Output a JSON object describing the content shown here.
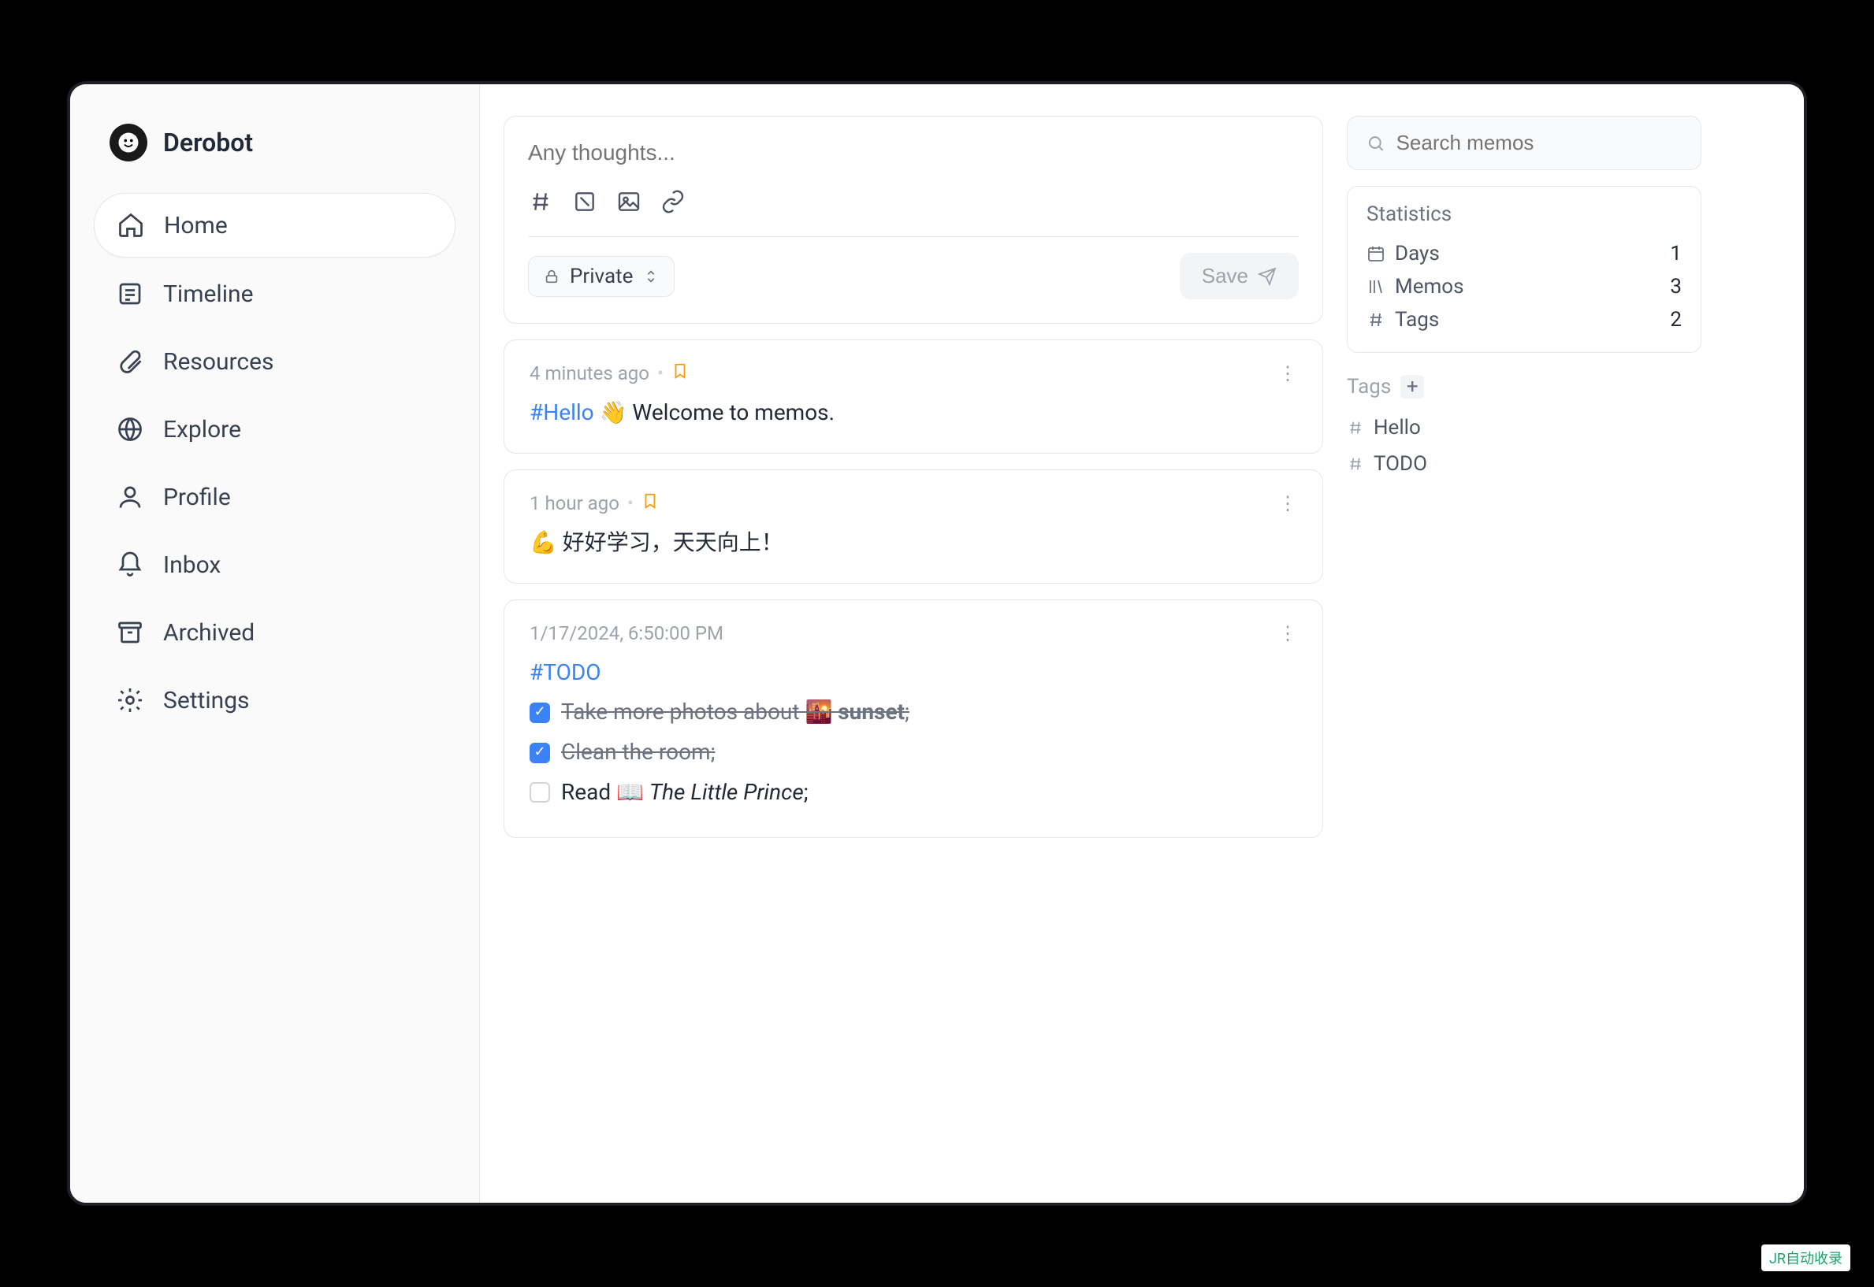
{
  "brand": {
    "name": "Derobot"
  },
  "nav": [
    {
      "id": "home",
      "label": "Home",
      "active": true
    },
    {
      "id": "timeline",
      "label": "Timeline",
      "active": false
    },
    {
      "id": "resources",
      "label": "Resources",
      "active": false
    },
    {
      "id": "explore",
      "label": "Explore",
      "active": false
    },
    {
      "id": "profile",
      "label": "Profile",
      "active": false
    },
    {
      "id": "inbox",
      "label": "Inbox",
      "active": false
    },
    {
      "id": "archived",
      "label": "Archived",
      "active": false
    },
    {
      "id": "settings",
      "label": "Settings",
      "active": false
    }
  ],
  "composer": {
    "placeholder": "Any thoughts...",
    "visibility": "Private",
    "save_label": "Save"
  },
  "memos": [
    {
      "time": "4 minutes ago",
      "pinned": true,
      "tag": "#Hello",
      "body_rest": " 👋 Welcome to memos."
    },
    {
      "time": "1 hour ago",
      "pinned": true,
      "body": "💪 好好学习，天天向上！"
    },
    {
      "time": "1/17/2024, 6:50:00 PM",
      "pinned": false,
      "tag": "#TODO",
      "todos": [
        {
          "done": true,
          "text_pre": "Take more photos about 🌇 ",
          "text_bold": "sunset",
          "text_post": ";"
        },
        {
          "done": true,
          "text": "Clean the room;"
        },
        {
          "done": false,
          "text_pre": "Read 📖 ",
          "text_italic": "The Little Prince",
          "text_post": ";"
        }
      ]
    }
  ],
  "search": {
    "placeholder": "Search memos"
  },
  "statistics": {
    "title": "Statistics",
    "rows": [
      {
        "label": "Days",
        "value": "1"
      },
      {
        "label": "Memos",
        "value": "3"
      },
      {
        "label": "Tags",
        "value": "2"
      }
    ]
  },
  "tags": {
    "title": "Tags",
    "items": [
      {
        "label": "Hello"
      },
      {
        "label": "TODO"
      }
    ]
  },
  "watermark": "JR自动收录"
}
